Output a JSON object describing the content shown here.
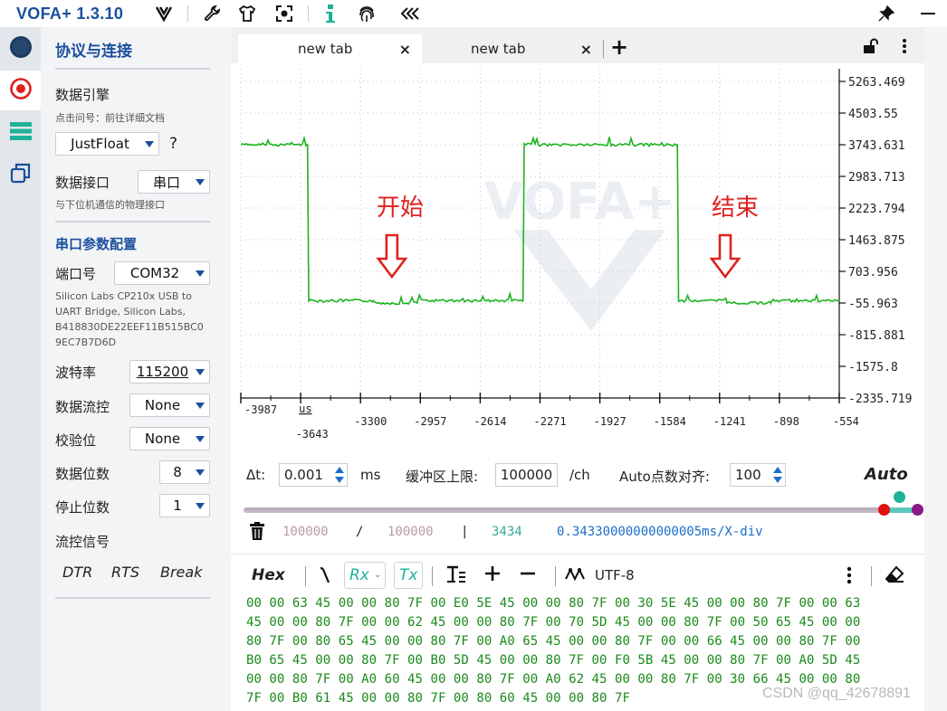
{
  "app": {
    "title": "VOFA+ 1.3.10",
    "watermark": "CSDN @qq_42678891"
  },
  "colors": {
    "brand": "#1a4f9c",
    "waveform": "#1db320",
    "annotation": "#e02020",
    "hex_text": "#1a8a1a",
    "stat_muted": "#b89aa8",
    "stat_count": "#3aa89a",
    "stat_div": "#1a6fc9"
  },
  "sidebar": {
    "section_title": "协议与连接",
    "engine": {
      "label": "数据引擎",
      "hint": "点击问号：前往详细文档",
      "value": "JustFloat",
      "help": "?"
    },
    "interface": {
      "label": "数据接口",
      "value": "串口",
      "hint": "与下位机通信的物理接口"
    },
    "serial_section": "串口参数配置",
    "port": {
      "label": "端口号",
      "value": "COM32",
      "desc_lines": [
        "Silicon Labs CP210x USB to",
        "UART Bridge, Silicon Labs,",
        "B418830DE22EEF11B515BC0",
        "9EC7B7D6D"
      ]
    },
    "baud": {
      "label": "波特率",
      "value": "115200"
    },
    "flow": {
      "label": "数据流控",
      "value": "None"
    },
    "parity": {
      "label": "校验位",
      "value": "None"
    },
    "databits": {
      "label": "数据位数",
      "value": "8"
    },
    "stopbits": {
      "label": "停止位数",
      "value": "1"
    },
    "flow_signals": {
      "label": "流控信号",
      "buttons": [
        "DTR",
        "RTS",
        "Break"
      ]
    }
  },
  "tabs": [
    {
      "label": "new tab",
      "close": "×"
    },
    {
      "label": "new tab",
      "close": "×"
    }
  ],
  "tab_add": "+",
  "chart_data": {
    "type": "line",
    "y_ticks": [
      "5263.469",
      "4503.55",
      "3743.631",
      "2983.713",
      "2223.794",
      "1463.875",
      "703.956",
      "-55.963",
      "-815.881",
      "-1575.8",
      "-2335.719"
    ],
    "x_ticks_upper": [
      "-3987",
      "us"
    ],
    "x_ticks_lower": [
      "-3643",
      "-3300",
      "-2957",
      "-2614",
      "-2271",
      "-1927",
      "-1584",
      "-1241",
      "-898",
      "-554"
    ],
    "ylim": [
      -2335.719,
      5263.469
    ],
    "series": [
      {
        "points": [
          [
            0,
            3743
          ],
          [
            0.1115,
            3743
          ],
          [
            0.1135,
            0
          ],
          [
            0.2215,
            0
          ],
          [
            0.2225,
            -55
          ],
          [
            0.2945,
            -55
          ],
          [
            0.2955,
            0
          ],
          [
            0.4715,
            0
          ],
          [
            0.4735,
            3743
          ],
          [
            0.7295,
            3743
          ],
          [
            0.7315,
            0
          ],
          [
            0.8115,
            0
          ],
          [
            0.8125,
            -55
          ],
          [
            0.8855,
            -55
          ],
          [
            0.8865,
            0
          ],
          [
            1.0,
            0
          ]
        ]
      }
    ],
    "annotations": [
      {
        "text": "开始",
        "x": 0.26,
        "y": 2223.794
      },
      {
        "text": "结束",
        "x": 0.82,
        "y": 2223.794
      }
    ],
    "watermark_text": "VOFA+",
    "grid": true
  },
  "controls": {
    "dt_label": "Δt:",
    "dt_value": "0.001",
    "dt_unit": "ms",
    "buffer_label": "缓冲区上限:",
    "buffer_value": "100000",
    "buffer_unit": "/ch",
    "autopts_label": "Auto点数对齐:",
    "autopts_value": "100",
    "auto_label": "Auto"
  },
  "stats": {
    "a": "100000",
    "slash": "/",
    "b": "100000",
    "bar": "|",
    "count": "3434",
    "div": "0.34330000000000005ms/X-div"
  },
  "receive": {
    "hex_label": "Hex",
    "rx_label": "Rx",
    "tx_label": "Tx",
    "encoding": "UTF-8",
    "lines": [
      "00 00 63 45 00 00 80 7F 00 E0 5E 45 00 00 80 7F 00 30 5E 45 00 00 80 7F 00 00 63",
      "45 00 00 80 7F 00 00 62 45 00 00 80 7F 00 70 5D 45 00 00 80 7F 00 50 65 45 00 00",
      "80 7F 00 80 65 45 00 00 80 7F 00 A0 65 45 00 00 80 7F 00 00 66 45 00 00 80 7F 00",
      "B0 65 45 00 00 80 7F 00 B0 5D 45 00 00 80 7F 00 F0 5B 45 00 00 80 7F 00 A0 5D 45",
      "00 00 80 7F 00 A0 60 45 00 00 80 7F 00 A0 62 45 00 00 80 7F 00 30 66 45 00 00 80",
      "7F 00 B0 61 45 00 00 80 7F 00 80 60 45 00 00 80 7F"
    ]
  }
}
